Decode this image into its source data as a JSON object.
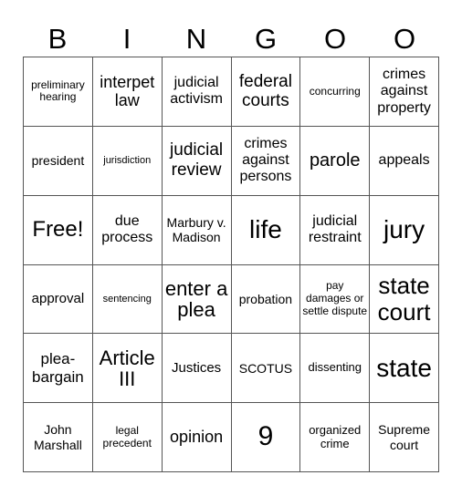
{
  "header": [
    "B",
    "I",
    "N",
    "G",
    "O",
    "O"
  ],
  "cells": [
    [
      "preliminary hearing",
      "interpet law",
      "judicial activism",
      "federal courts",
      "concurring",
      "crimes against property"
    ],
    [
      "president",
      "jurisdiction",
      "judicial review",
      "crimes against persons",
      "parole",
      "appeals"
    ],
    [
      "Free!",
      "due process",
      "Marbury v. Madison",
      "life",
      "judicial restraint",
      "jury"
    ],
    [
      "approval",
      "sentencing",
      "enter a plea",
      "probation",
      "pay damages or settle dispute",
      "state court"
    ],
    [
      "plea-bargain",
      "Article III",
      "Justices",
      "SCOTUS",
      "dissenting",
      "state"
    ],
    [
      "John Marshall",
      "legal precedent",
      "opinion",
      "9",
      "organized crime",
      "Supreme court"
    ]
  ]
}
